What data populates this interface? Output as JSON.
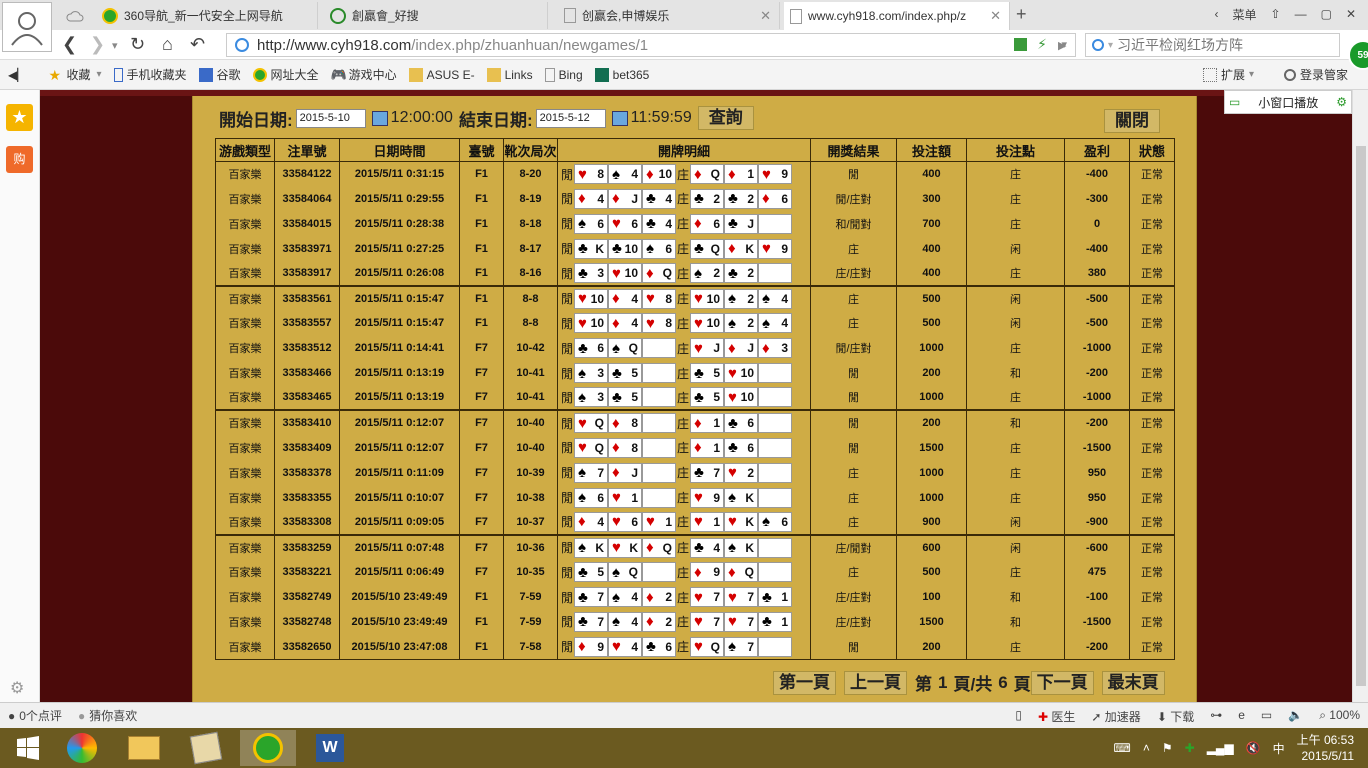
{
  "browser": {
    "tabs": [
      {
        "label": "360导航_新一代安全上网导航",
        "active": false
      },
      {
        "label": "創贏會_好搜",
        "active": false
      },
      {
        "label": "创赢会,申博娱乐",
        "active": false
      },
      {
        "label": "www.cyh918.com/index.php/z",
        "active": true
      }
    ],
    "menu_label": "菜单",
    "url_host": "http://www.cyh918.com",
    "url_path": "/index.php/zhuanhuan/newgames/1",
    "search_placeholder": "习近平检阅红场方阵",
    "badge_count": "59",
    "bookmarks": [
      "收藏",
      "手机收藏夹",
      "谷歌",
      "网址大全",
      "游戏中心",
      "ASUS E-",
      "Links",
      "Bing",
      "bet365"
    ],
    "bookmarks_right": [
      "扩展",
      "登录管家"
    ],
    "mini_window_label": "小窗口播放",
    "status_left": [
      "0个点评",
      "猜你喜欢"
    ],
    "status_right": [
      "医生",
      "加速器",
      "下载",
      "100%"
    ]
  },
  "filter": {
    "start_label": "開始日期:",
    "start_date": "2015-5-10",
    "start_time": "12:00:00",
    "end_label": "結束日期:",
    "end_date": "2015-5-12",
    "end_time": "11:59:59",
    "query_button": "查詢",
    "close_button": "關閉"
  },
  "table": {
    "headers": [
      "游戲類型",
      "注單號",
      "日期時間",
      "臺號",
      "靴次局次",
      "開牌明細",
      "開獎結果",
      "投注額",
      "投注點",
      "盈利",
      "狀態"
    ],
    "player_label": "閒",
    "banker_label": "庄",
    "rows": [
      {
        "type": "百家樂",
        "id": "33584122",
        "time": "2015/5/11 0:31:15",
        "table": "F1",
        "round": "8-20",
        "p": [
          "♥8",
          "♠4",
          "♦10"
        ],
        "b": [
          "♦Q",
          "♦1",
          "♥9"
        ],
        "result": "閒",
        "amount": "400",
        "bet": "庄",
        "profit": "-400",
        "status": "正常"
      },
      {
        "type": "百家樂",
        "id": "33584064",
        "time": "2015/5/11 0:29:55",
        "table": "F1",
        "round": "8-19",
        "p": [
          "♦4",
          "♦J",
          "♣4"
        ],
        "b": [
          "♣2",
          "♣2",
          "♦6"
        ],
        "result": "閒/庄對",
        "amount": "300",
        "bet": "庄",
        "profit": "-300",
        "status": "正常"
      },
      {
        "type": "百家樂",
        "id": "33584015",
        "time": "2015/5/11 0:28:38",
        "table": "F1",
        "round": "8-18",
        "p": [
          "♠6",
          "♥6",
          "♣4"
        ],
        "b": [
          "♦6",
          "♣J",
          ""
        ],
        "result": "和/閒對",
        "amount": "700",
        "bet": "庄",
        "profit": "0",
        "status": "正常"
      },
      {
        "type": "百家樂",
        "id": "33583971",
        "time": "2015/5/11 0:27:25",
        "table": "F1",
        "round": "8-17",
        "p": [
          "♣K",
          "♣10",
          "♠6"
        ],
        "b": [
          "♣Q",
          "♦K",
          "♥9"
        ],
        "result": "庄",
        "amount": "400",
        "bet": "闲",
        "profit": "-400",
        "status": "正常"
      },
      {
        "type": "百家樂",
        "id": "33583917",
        "time": "2015/5/11 0:26:08",
        "table": "F1",
        "round": "8-16",
        "p": [
          "♣3",
          "♥10",
          "♦Q"
        ],
        "b": [
          "♠2",
          "♣2",
          ""
        ],
        "result": "庄/庄對",
        "amount": "400",
        "bet": "庄",
        "profit": "380",
        "status": "正常"
      },
      {
        "type": "百家樂",
        "id": "33583561",
        "time": "2015/5/11 0:15:47",
        "table": "F1",
        "round": "8-8",
        "p": [
          "♥10",
          "♦4",
          "♥8"
        ],
        "b": [
          "♥10",
          "♠2",
          "♠4"
        ],
        "result": "庄",
        "amount": "500",
        "bet": "闲",
        "profit": "-500",
        "status": "正常"
      },
      {
        "type": "百家樂",
        "id": "33583557",
        "time": "2015/5/11 0:15:47",
        "table": "F1",
        "round": "8-8",
        "p": [
          "♥10",
          "♦4",
          "♥8"
        ],
        "b": [
          "♥10",
          "♠2",
          "♠4"
        ],
        "result": "庄",
        "amount": "500",
        "bet": "闲",
        "profit": "-500",
        "status": "正常"
      },
      {
        "type": "百家樂",
        "id": "33583512",
        "time": "2015/5/11 0:14:41",
        "table": "F7",
        "round": "10-42",
        "p": [
          "♣6",
          "♠Q",
          ""
        ],
        "b": [
          "♥J",
          "♦J",
          "♦3"
        ],
        "result": "閒/庄對",
        "amount": "1000",
        "bet": "庄",
        "profit": "-1000",
        "status": "正常"
      },
      {
        "type": "百家樂",
        "id": "33583466",
        "time": "2015/5/11 0:13:19",
        "table": "F7",
        "round": "10-41",
        "p": [
          "♠3",
          "♣5",
          ""
        ],
        "b": [
          "♣5",
          "♥10",
          ""
        ],
        "result": "閒",
        "amount": "200",
        "bet": "和",
        "profit": "-200",
        "status": "正常"
      },
      {
        "type": "百家樂",
        "id": "33583465",
        "time": "2015/5/11 0:13:19",
        "table": "F7",
        "round": "10-41",
        "p": [
          "♠3",
          "♣5",
          ""
        ],
        "b": [
          "♣5",
          "♥10",
          ""
        ],
        "result": "閒",
        "amount": "1000",
        "bet": "庄",
        "profit": "-1000",
        "status": "正常"
      },
      {
        "type": "百家樂",
        "id": "33583410",
        "time": "2015/5/11 0:12:07",
        "table": "F7",
        "round": "10-40",
        "p": [
          "♥Q",
          "♦8",
          ""
        ],
        "b": [
          "♦1",
          "♣6",
          ""
        ],
        "result": "閒",
        "amount": "200",
        "bet": "和",
        "profit": "-200",
        "status": "正常"
      },
      {
        "type": "百家樂",
        "id": "33583409",
        "time": "2015/5/11 0:12:07",
        "table": "F7",
        "round": "10-40",
        "p": [
          "♥Q",
          "♦8",
          ""
        ],
        "b": [
          "♦1",
          "♣6",
          ""
        ],
        "result": "閒",
        "amount": "1500",
        "bet": "庄",
        "profit": "-1500",
        "status": "正常"
      },
      {
        "type": "百家樂",
        "id": "33583378",
        "time": "2015/5/11 0:11:09",
        "table": "F7",
        "round": "10-39",
        "p": [
          "♠7",
          "♦J",
          ""
        ],
        "b": [
          "♣7",
          "♥2",
          ""
        ],
        "result": "庄",
        "amount": "1000",
        "bet": "庄",
        "profit": "950",
        "status": "正常"
      },
      {
        "type": "百家樂",
        "id": "33583355",
        "time": "2015/5/11 0:10:07",
        "table": "F7",
        "round": "10-38",
        "p": [
          "♠6",
          "♥1",
          ""
        ],
        "b": [
          "♥9",
          "♠K",
          ""
        ],
        "result": "庄",
        "amount": "1000",
        "bet": "庄",
        "profit": "950",
        "status": "正常"
      },
      {
        "type": "百家樂",
        "id": "33583308",
        "time": "2015/5/11 0:09:05",
        "table": "F7",
        "round": "10-37",
        "p": [
          "♦4",
          "♥6",
          "♥1"
        ],
        "b": [
          "♥1",
          "♥K",
          "♠6"
        ],
        "result": "庄",
        "amount": "900",
        "bet": "闲",
        "profit": "-900",
        "status": "正常"
      },
      {
        "type": "百家樂",
        "id": "33583259",
        "time": "2015/5/11 0:07:48",
        "table": "F7",
        "round": "10-36",
        "p": [
          "♠K",
          "♥K",
          "♦Q"
        ],
        "b": [
          "♣4",
          "♠K",
          ""
        ],
        "result": "庄/閒對",
        "amount": "600",
        "bet": "闲",
        "profit": "-600",
        "status": "正常"
      },
      {
        "type": "百家樂",
        "id": "33583221",
        "time": "2015/5/11 0:06:49",
        "table": "F7",
        "round": "10-35",
        "p": [
          "♣5",
          "♠Q",
          ""
        ],
        "b": [
          "♦9",
          "♦Q",
          ""
        ],
        "result": "庄",
        "amount": "500",
        "bet": "庄",
        "profit": "475",
        "status": "正常"
      },
      {
        "type": "百家樂",
        "id": "33582749",
        "time": "2015/5/10 23:49:49",
        "table": "F1",
        "round": "7-59",
        "p": [
          "♣7",
          "♠4",
          "♦2"
        ],
        "b": [
          "♥7",
          "♥7",
          "♣1"
        ],
        "result": "庄/庄對",
        "amount": "100",
        "bet": "和",
        "profit": "-100",
        "status": "正常"
      },
      {
        "type": "百家樂",
        "id": "33582748",
        "time": "2015/5/10 23:49:49",
        "table": "F1",
        "round": "7-59",
        "p": [
          "♣7",
          "♠4",
          "♦2"
        ],
        "b": [
          "♥7",
          "♥7",
          "♣1"
        ],
        "result": "庄/庄對",
        "amount": "1500",
        "bet": "和",
        "profit": "-1500",
        "status": "正常"
      },
      {
        "type": "百家樂",
        "id": "33582650",
        "time": "2015/5/10 23:47:08",
        "table": "F1",
        "round": "7-58",
        "p": [
          "♦9",
          "♥4",
          "♣6"
        ],
        "b": [
          "♥Q",
          "♠7",
          ""
        ],
        "result": "閒",
        "amount": "200",
        "bet": "庄",
        "profit": "-200",
        "status": "正常"
      }
    ]
  },
  "pager": {
    "first": "第一頁",
    "prev": "上一頁",
    "page_prefix": "第",
    "current": "1",
    "page_mid": "頁/共",
    "total": "6",
    "page_suffix": "頁",
    "next": "下一頁",
    "last": "最末頁"
  },
  "taskbar": {
    "ime": "中",
    "time": "上午 06:53",
    "date": "2015/5/11"
  },
  "colors": {
    "panel": "#cfac45",
    "loss": "#e00000",
    "background": "#4b0a0a"
  }
}
